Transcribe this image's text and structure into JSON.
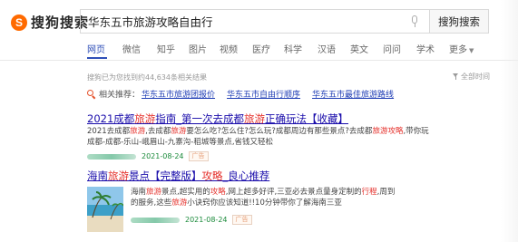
{
  "brand": {
    "logo_glyph": "S",
    "name": "搜狗搜索",
    "color": "#ff6a00"
  },
  "search": {
    "query": "华东五市旅游攻略自由行",
    "button_label": "搜狗搜索"
  },
  "tabs": [
    "网页",
    "微信",
    "知乎",
    "图片",
    "视频",
    "医疗",
    "科学",
    "汉语",
    "英文",
    "问问",
    "学术",
    "更多"
  ],
  "active_tab": "网页",
  "stats": {
    "result_count_text": "搜狗已为您找到约44,634条相关结果",
    "time_filter": "全部时间"
  },
  "related": {
    "label": "相关推荐：",
    "links": [
      "华东五市旅游团报价",
      "华东五市自由行顺序",
      "华东五市最佳旅游路线"
    ]
  },
  "results": [
    {
      "title_parts": [
        "2021成都",
        "旅游",
        "指南_第一次去成都",
        "旅游",
        "正确玩法【收藏】"
      ],
      "desc_parts": [
        "2021去成都",
        "旅游",
        ",去成都",
        "旅游",
        "要怎么吃?怎么住?怎么玩?成都周边有那些景点?去成都",
        "旅游",
        "攻略",
        ",带你玩成都-成都-乐山-峨眉山-九寨沟-稻城等景点,省钱又轻松"
      ],
      "date": "2021-08-24",
      "ad_label": "广告"
    },
    {
      "title_parts": [
        "海南",
        "旅游",
        "景点【完整版】",
        "攻略",
        "_良心推荐"
      ],
      "desc_parts": [
        "海南",
        "旅游",
        "景点,超实用的",
        "攻略",
        ",网上超多好评,三亚必去景点量身定制的",
        "行程",
        ",周到的服务,这些",
        "旅游",
        "小诀窍你应该知道!!10分钟带你了解海南三亚"
      ],
      "date": "2021-08-24",
      "ad_label": "广告"
    }
  ],
  "colors": {
    "link": "#1a0dab",
    "highlight": "#e5322d",
    "date": "#1a8a3a",
    "active_tab": "#2f4fb8"
  }
}
